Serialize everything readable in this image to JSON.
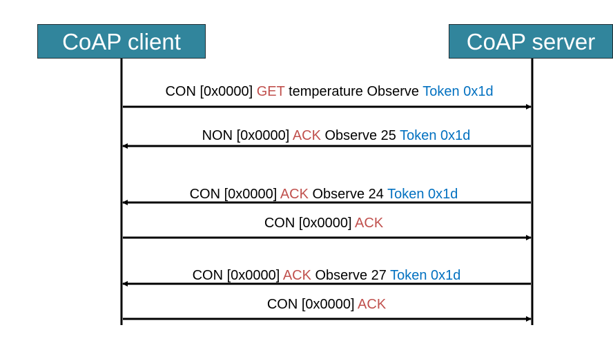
{
  "participants": {
    "client": "CoAP client",
    "server": "CoAP server"
  },
  "colors": {
    "box_fill": "#31859c",
    "keyword_red": "#c0504d",
    "token_blue": "#0070c0"
  },
  "messages": [
    {
      "direction": "client-to-server",
      "type": "CON",
      "id": "[0x0000]",
      "code": "GET",
      "payload": "temperature Observe",
      "token": "Token 0x1d"
    },
    {
      "direction": "server-to-client",
      "type": "NON",
      "id": "[0x0000]",
      "code": "ACK",
      "payload": "Observe 25",
      "token": "Token 0x1d"
    },
    {
      "direction": "server-to-client",
      "type": "CON",
      "id": "[0x0000]",
      "code": "ACK",
      "payload": "Observe 24",
      "token": "Token 0x1d"
    },
    {
      "direction": "client-to-server",
      "type": "CON",
      "id": "[0x0000]",
      "code": "ACK",
      "payload": "",
      "token": ""
    },
    {
      "direction": "server-to-client",
      "type": "CON",
      "id": "[0x0000]",
      "code": "ACK",
      "payload": "Observe 27",
      "token": "Token 0x1d"
    },
    {
      "direction": "client-to-server",
      "type": "CON",
      "id": "[0x0000]",
      "code": "ACK",
      "payload": "",
      "token": ""
    }
  ]
}
